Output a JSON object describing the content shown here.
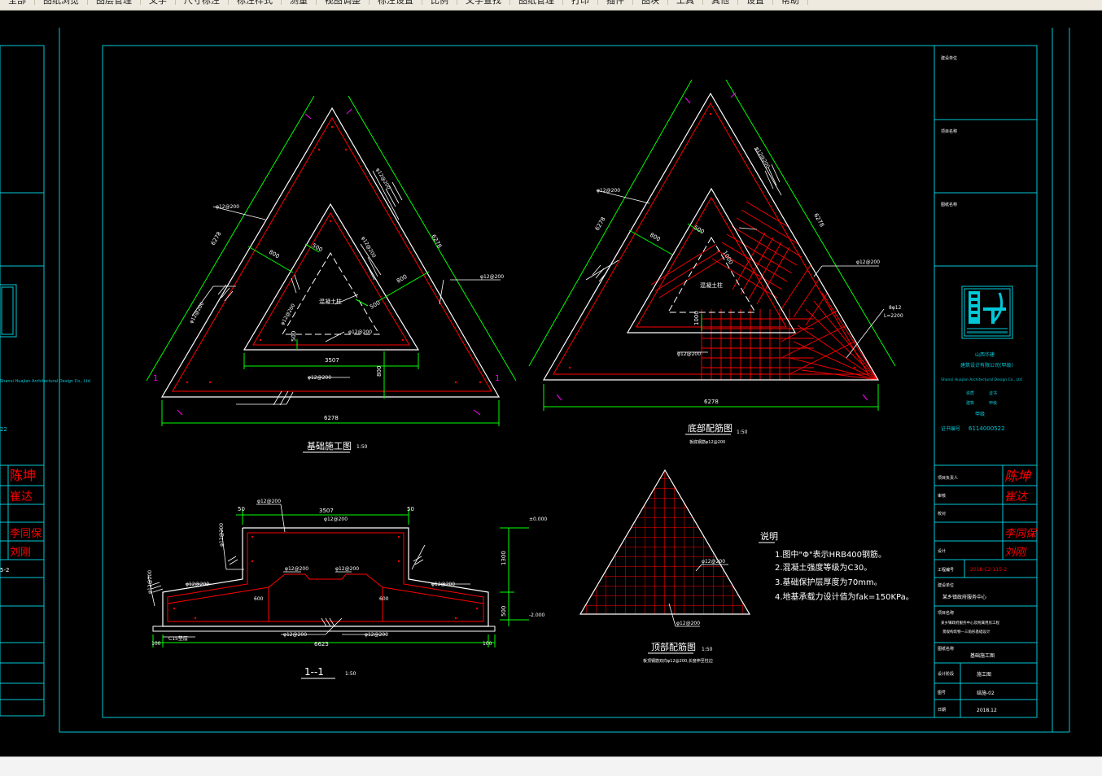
{
  "menu": {
    "items": [
      "全部",
      "图纸浏览",
      "图层管理",
      "文字",
      "尺寸标注",
      "标注样式",
      "测量",
      "视图调整",
      "标注设置",
      "比例",
      "文字查找",
      "图纸管理",
      "打印",
      "插件",
      "图块",
      "工具",
      "其他",
      "设置",
      "帮助"
    ]
  },
  "colors": {
    "background": "#000000",
    "frame": "#00c8d8",
    "dim": "#00ff00",
    "rebar": "#ff0000",
    "text": "#ffffff",
    "magenta": "#ff00ff",
    "sign": "#ff0000"
  },
  "plan_drawing": {
    "title": "基础施工图",
    "scale": "1:50",
    "dim_6278_left": "6278",
    "dim_6278_right": "6278",
    "dim_6278_bottom": "6278",
    "dim_800_a": "800",
    "dim_800_b": "800",
    "dim_800_c": "800",
    "dim_500_a": "500",
    "dim_500_b": "500",
    "dim_500_c": "500",
    "dim_3507": "3507",
    "rebar_label_1": "φ12@200",
    "rebar_label_2": "φ12@200",
    "rebar_label_3": "φ12@200",
    "rebar_label_4": "φ12@200",
    "rebar_label_5": "φ12@200",
    "rebar_label_6": "φ12@200",
    "rebar_label_7": "φ12@200",
    "rebar_label_8": "φ12@200",
    "column_label": "混凝土柱",
    "section_mark": "1"
  },
  "bottom_rebar_drawing": {
    "title": "底部配筋图",
    "scale": "1:50",
    "subtitle": "板底钢筋φ12@200",
    "dim_6278_left": "6278",
    "dim_6278_right": "6278",
    "dim_6278_bottom": "6278",
    "dim_800": "800",
    "dim_500": "500",
    "dim_1000_a": "1000",
    "dim_1000_b": "1000",
    "rebar_label_1": "φ12@200",
    "rebar_label_2": "φ12@200",
    "rebar_label_3": "φ12@200",
    "rebar_label_4": "φ12@200",
    "column_label": "混凝土柱",
    "bar_note_1": "8φ12",
    "bar_note_2": "L=2200"
  },
  "section_drawing": {
    "title": "1--1",
    "scale": "1:50",
    "dim_3507": "3507",
    "dim_50_left": "50",
    "dim_50_right": "50",
    "dim_600_left": "600",
    "dim_600_right": "600",
    "dim_6625": "6625",
    "dim_100_left": "100",
    "dim_100_right": "100",
    "dim_1300": "1300",
    "dim_500": "500",
    "elev_top": "±0.000",
    "elev_bottom": "-2.000",
    "cushion": "C15垫层",
    "rebar_label_top": "φ12@200",
    "rebar_label_a": "φ12@200",
    "rebar_label_b": "φ12@200",
    "rebar_label_c": "φ12@200",
    "rebar_label_d": "φ12@200",
    "rebar_label_e": "φ12@200",
    "rebar_label_f": "φ12@200",
    "rebar_label_g": "φ12@200",
    "rebar_label_h": "φ12@200",
    "rebar_label_i": "φ12@200"
  },
  "top_rebar_drawing": {
    "title": "顶部配筋图",
    "scale": "1:50",
    "subtitle": "板顶钢筋双向φ12@200,长度伸至柱边",
    "rebar_label_1": "φ12@200",
    "rebar_label_2": "φ12@200"
  },
  "notes": {
    "heading": "说明",
    "items": [
      "1.图中\"Φ\"表示HRB400钢筋。",
      "2.混凝土强度等级为C30。",
      "3.基础保护层厚度为70mm。",
      "4.地基承载力设计值为fak=150KPa。"
    ]
  },
  "title_block": {
    "row_owner": "建设单位",
    "row_project": "项目名称",
    "row_drawing": "图纸名称",
    "company_cn_1": "山西华建",
    "company_cn_2": "建筑设计有限公司(甲级)",
    "company_en": "Shanxi Huajian Architectural Design Co., Ltd",
    "cert_a": "资质",
    "cert_b": "证书",
    "cert_c": "建筑",
    "cert_d": "甲级",
    "cert_e": "甲级",
    "cert_no_label": "证书编号",
    "cert_no": "6114000522",
    "sig_role_1": "项目负责人",
    "sig_role_2": "审核",
    "sig_role_3": "校对",
    "sig_role_4": "设计",
    "sig_name_1": "陈坤",
    "sig_name_2": "崔达",
    "sig_name_3": "李同保",
    "sig_name_4": "刘刚",
    "project_no_label": "工程编号",
    "project_no": "2018-C2-115-2",
    "client_label": "建设单位",
    "client": "某乡镇政府服务中心",
    "project_label": "项目名称",
    "project_line1": "某乡镇政府服务中心及附属用房工程",
    "project_line2": "景观构筑物—三角形基础设计",
    "drawing_label": "图纸名称",
    "drawing_name": "基础施工图",
    "stage_label": "设计阶段",
    "stage": "施工图",
    "sheet_label": "图号",
    "sheet": "结施-02",
    "date_label": "日期",
    "date": "2018.12"
  },
  "left_sheet": {
    "company_en": "Shanxi Huajian Architectural Design Co., Ltd",
    "cert_no": "22",
    "project_no": "5-2"
  }
}
